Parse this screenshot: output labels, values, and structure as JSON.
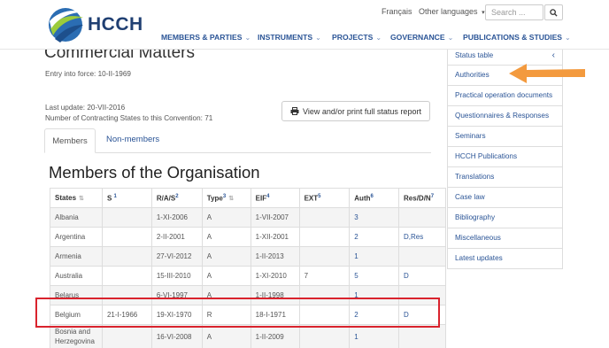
{
  "header": {
    "logo_text": "HCCH",
    "lang_fr": "Français",
    "lang_other": "Other languages",
    "search_placeholder": "Search ...",
    "nav": [
      {
        "label": "MEMBERS & PARTIES"
      },
      {
        "label": "INSTRUMENTS"
      },
      {
        "label": "PROJECTS"
      },
      {
        "label": "GOVERNANCE"
      },
      {
        "label": "PUBLICATIONS & STUDIES"
      }
    ]
  },
  "main": {
    "title": "Commercial Matters",
    "entry_into_force": "Entry into force: 10-II-1969",
    "last_update": "Last update: 20-VII-2016",
    "num_states": "Number of Contracting States to this Convention: 71",
    "status_button": "View and/or print full status report",
    "tabs": [
      {
        "label": "Members"
      },
      {
        "label": "Non-members"
      }
    ],
    "section_title": "Members of the Organisation"
  },
  "table": {
    "headers": [
      {
        "label": "States",
        "sup": ""
      },
      {
        "label": "S",
        "sup": "1"
      },
      {
        "label": "R/A/S",
        "sup": "2"
      },
      {
        "label": "Type",
        "sup": "3"
      },
      {
        "label": "EIF",
        "sup": "4"
      },
      {
        "label": "EXT",
        "sup": "5"
      },
      {
        "label": "Auth",
        "sup": "6"
      },
      {
        "label": "Res/D/N",
        "sup": "7"
      }
    ],
    "rows": [
      [
        "Albania",
        "",
        "1-XI-2006",
        "A",
        "1-VII-2007",
        "",
        "3",
        ""
      ],
      [
        "Argentina",
        "",
        "2-II-2001",
        "A",
        "1-XII-2001",
        "",
        "2",
        "D,Res"
      ],
      [
        "Armenia",
        "",
        "27-VI-2012",
        "A",
        "1-II-2013",
        "",
        "1",
        ""
      ],
      [
        "Australia",
        "",
        "15-III-2010",
        "A",
        "1-XI-2010",
        "7",
        "5",
        "D"
      ],
      [
        "Belarus",
        "",
        "6-VI-1997",
        "A",
        "1-II-1998",
        "",
        "1",
        ""
      ],
      [
        "Belgium",
        "21-I-1966",
        "19-XI-1970",
        "R",
        "18-I-1971",
        "",
        "2",
        "D"
      ],
      [
        "Bosnia and Herzegovina",
        "",
        "16-VI-2008",
        "A",
        "1-II-2009",
        "",
        "1",
        ""
      ]
    ]
  },
  "sidebar": {
    "items": [
      {
        "label": "Status table"
      },
      {
        "label": "Authorities"
      },
      {
        "label": "Practical operation documents"
      },
      {
        "label": "Questionnaires & Responses"
      },
      {
        "label": "Seminars"
      },
      {
        "label": "HCCH Publications"
      },
      {
        "label": "Translations"
      },
      {
        "label": "Case law"
      },
      {
        "label": "Bibliography"
      },
      {
        "label": "Miscellaneous"
      },
      {
        "label": "Latest updates"
      }
    ]
  },
  "colors": {
    "brand_blue": "#2a5496",
    "highlight_red": "#d9232d",
    "arrow_orange": "#f39a3e"
  }
}
